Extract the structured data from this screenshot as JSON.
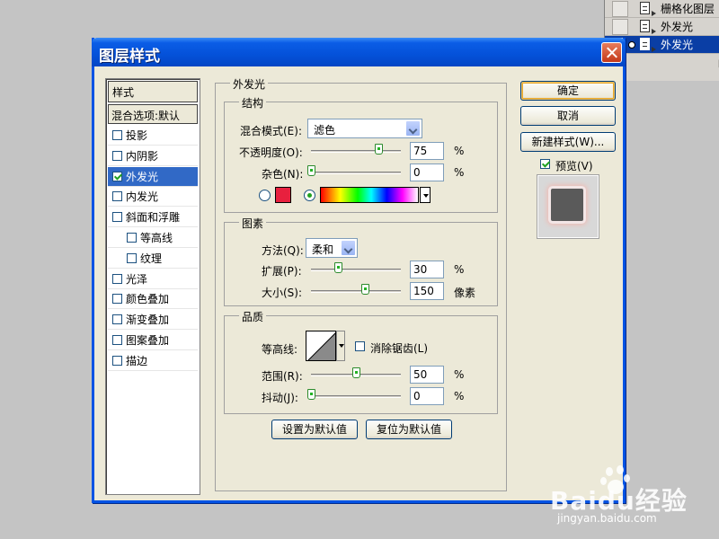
{
  "layers_panel": {
    "rows": [
      {
        "label": "栅格化图层"
      },
      {
        "label": "外发光"
      },
      {
        "label": "外发光"
      }
    ],
    "bottom_mark": "["
  },
  "dialog": {
    "title": "图层样式"
  },
  "style_list": {
    "header": "样式",
    "blend_options": "混合选项:默认",
    "items": [
      {
        "label": "投影",
        "checked": false
      },
      {
        "label": "内阴影",
        "checked": false
      },
      {
        "label": "外发光",
        "checked": true
      },
      {
        "label": "内发光",
        "checked": false
      },
      {
        "label": "斜面和浮雕",
        "checked": false
      },
      {
        "label": "等高线",
        "checked": false
      },
      {
        "label": "纹理",
        "checked": false
      },
      {
        "label": "光泽",
        "checked": false
      },
      {
        "label": "颜色叠加",
        "checked": false
      },
      {
        "label": "渐变叠加",
        "checked": false
      },
      {
        "label": "图案叠加",
        "checked": false
      },
      {
        "label": "描边",
        "checked": false
      }
    ]
  },
  "outer_glow": {
    "title": "外发光",
    "structure": {
      "title": "结构",
      "blend_mode_label": "混合模式(E):",
      "blend_mode_value": "滤色",
      "opacity_label": "不透明度(O):",
      "opacity_value": "75",
      "opacity_fraction": 0.75,
      "opacity_unit": "%",
      "noise_label": "杂色(N):",
      "noise_value": "0",
      "noise_fraction": 0,
      "noise_unit": "%",
      "glow_color": "#e8203e"
    },
    "elements": {
      "title": "图素",
      "method_label": "方法(Q):",
      "method_value": "柔和",
      "spread_label": "扩展(P):",
      "spread_value": "30",
      "spread_fraction": 0.3,
      "spread_unit": "%",
      "size_label": "大小(S):",
      "size_value": "150",
      "size_fraction": 0.6,
      "size_unit": "像素"
    },
    "quality": {
      "title": "品质",
      "contour_label": "等高线:",
      "anti_alias_label": "消除锯齿(L)",
      "range_label": "范围(R):",
      "range_value": "50",
      "range_fraction": 0.5,
      "range_unit": "%",
      "jitter_label": "抖动(J):",
      "jitter_value": "0",
      "jitter_fraction": 0,
      "jitter_unit": "%"
    },
    "set_default_button": "设置为默认值",
    "reset_default_button": "复位为默认值"
  },
  "right_panel": {
    "ok_button": "确定",
    "cancel_button": "取消",
    "new_style_button": "新建样式(W)...",
    "preview_label": "预览(V)",
    "preview_checked": true
  },
  "watermark": {
    "brand": "Bai",
    "brand_suffix": "du经验",
    "url": "jingyan.baidu.com"
  }
}
